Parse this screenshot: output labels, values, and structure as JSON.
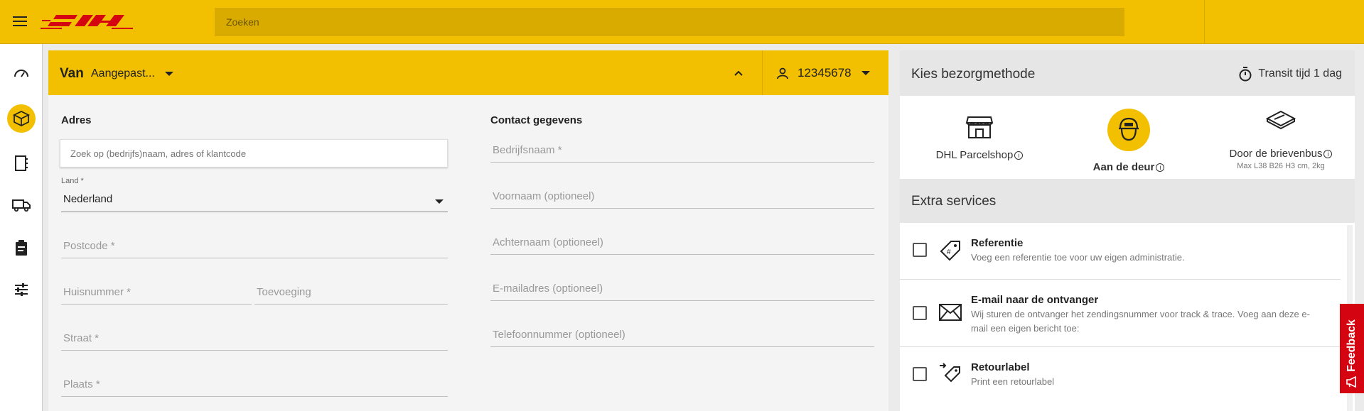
{
  "topbar": {
    "search_placeholder": "Zoeken",
    "logo_text": "DHL"
  },
  "sidebar": {
    "items": [
      {
        "name": "dashboard",
        "icon": "gauge-icon"
      },
      {
        "name": "shipments",
        "icon": "package-icon",
        "active": true
      },
      {
        "name": "addressbook",
        "icon": "addressbook-icon"
      },
      {
        "name": "transport",
        "icon": "truck-icon"
      },
      {
        "name": "orders",
        "icon": "clipboard-icon"
      },
      {
        "name": "settings",
        "icon": "sliders-icon"
      }
    ]
  },
  "from_panel": {
    "title": "Van",
    "preset": "Aangepast...",
    "account": "12345678",
    "address_section": "Adres",
    "contact_section": "Contact gegevens",
    "address_search_placeholder": "Zoek op (bedrijfs)naam, adres of klantcode",
    "country_label": "Land *",
    "country_value": "Nederland",
    "postcode": "Postcode *",
    "housenumber": "Huisnummer *",
    "addition": "Toevoeging",
    "street": "Straat *",
    "city": "Plaats *",
    "company": "Bedrijfsnaam *",
    "firstname": "Voornaam (optioneel)",
    "lastname": "Achternaam (optioneel)",
    "email": "E-mailadres (optioneel)",
    "phone": "Telefoonnummer (optioneel)"
  },
  "delivery": {
    "title": "Kies bezorgmethode",
    "transit": "Transit tijd 1 dag",
    "methods": [
      {
        "label": "DHL Parcelshop",
        "sub": "",
        "selected": false
      },
      {
        "label": "Aan de deur",
        "sub": "",
        "selected": true
      },
      {
        "label": "Door de brievenbus",
        "sub": "Max L38 B26 H3 cm, 2kg",
        "selected": false
      }
    ]
  },
  "extra": {
    "title": "Extra services",
    "services": [
      {
        "title": "Referentie",
        "desc": "Voeg een referentie toe voor uw eigen administratie."
      },
      {
        "title": "E-mail naar de ontvanger",
        "desc": "Wij sturen de ontvanger het zendingsnummer voor track & trace. Voeg aan deze e-mail een eigen bericht toe:"
      },
      {
        "title": "Retourlabel",
        "desc": "Print een retourlabel"
      }
    ]
  },
  "feedback": {
    "label": "Feedback"
  },
  "colors": {
    "brand_yellow": "#f2c000",
    "brand_red": "#d40511"
  }
}
